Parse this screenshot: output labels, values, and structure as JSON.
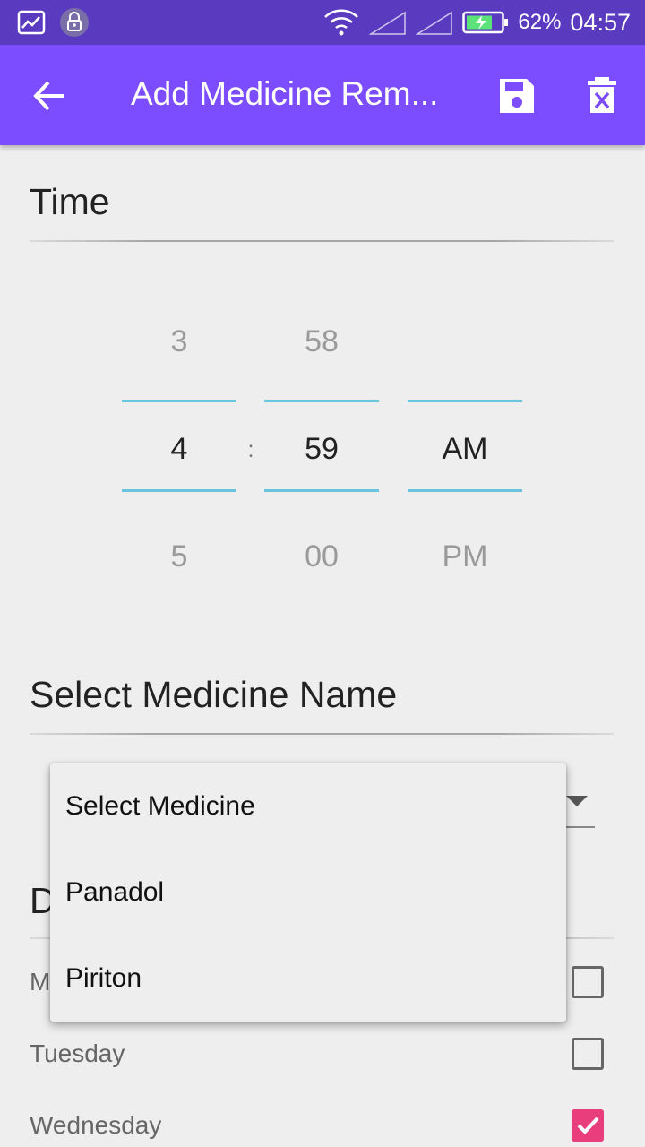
{
  "status_bar": {
    "battery": "62%",
    "time": "04:57",
    "icons": [
      "gallery-icon",
      "lock-icon",
      "wifi-icon",
      "signal-icon",
      "signal-icon",
      "battery-charging-icon"
    ]
  },
  "app_bar": {
    "title": "Add Medicine Rem...",
    "back_icon": "arrow-back-icon",
    "save_icon": "save-icon",
    "delete_icon": "delete-icon",
    "color": "#7c4dff"
  },
  "time_section": {
    "title": "Time",
    "hour": {
      "prev": "3",
      "selected": "4",
      "next": "5"
    },
    "separator": ":",
    "minute": {
      "prev": "58",
      "selected": "59",
      "next": "00"
    },
    "ampm": {
      "selected": "AM",
      "next": "PM"
    }
  },
  "medicine_section": {
    "title": "Select Medicine Name",
    "dropdown": {
      "options": [
        "Select Medicine",
        "Panadol",
        "Piriton"
      ]
    }
  },
  "days_section": {
    "title_partial": "D",
    "days": [
      {
        "label": "M",
        "checked": false
      },
      {
        "label": "Tuesday",
        "checked": false
      },
      {
        "label": "Wednesday",
        "checked": true
      }
    ],
    "check_color": "#e83e7b"
  }
}
